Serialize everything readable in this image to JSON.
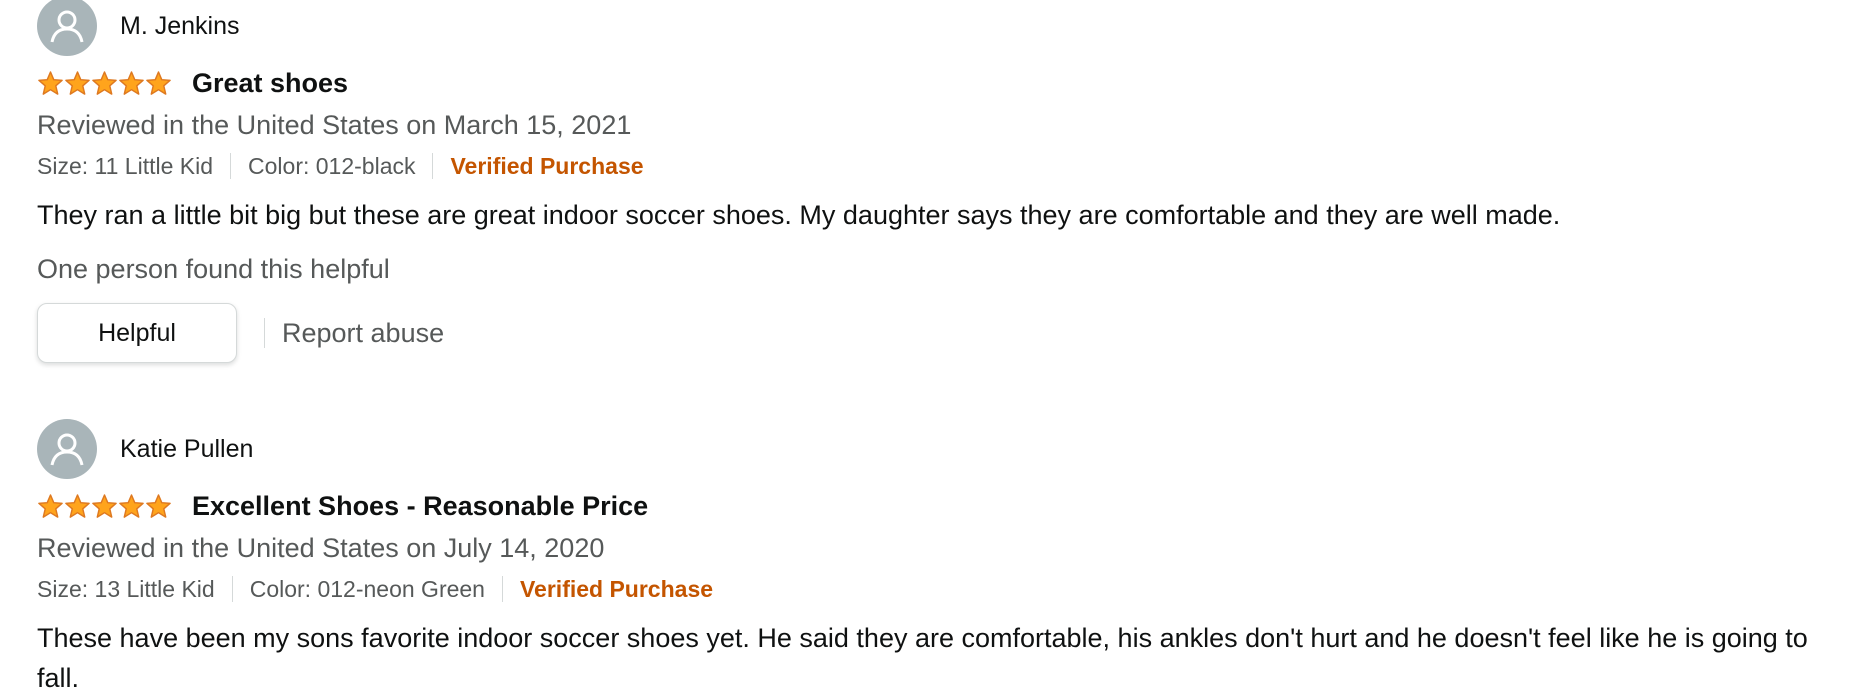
{
  "colors": {
    "star_fill": "#ffa41c",
    "star_stroke": "#de7921",
    "verified": "#c45500",
    "secondary_text": "#565959",
    "avatar_bg": "#a9b5b9"
  },
  "reviews": [
    {
      "profile_name": "M. Jenkins",
      "avatar_icon": "user-silhouette-icon",
      "rating": 5,
      "rating_max": 5,
      "title": "Great shoes",
      "date": "Reviewed in the United States on March 15, 2021",
      "size": "Size: 11 Little Kid",
      "color": "Color: 012-black",
      "verified": "Verified Purchase",
      "body": "They ran a little bit big but these are great indoor soccer shoes. My daughter says they are comfortable and they are well made.",
      "helpful_count": "One person found this helpful",
      "helpful_button": "Helpful",
      "report": "Report abuse"
    },
    {
      "profile_name": "Katie Pullen",
      "avatar_icon": "user-silhouette-icon",
      "rating": 5,
      "rating_max": 5,
      "title": "Excellent Shoes - Reasonable Price",
      "date": "Reviewed in the United States on July 14, 2020",
      "size": "Size: 13 Little Kid",
      "color": "Color: 012-neon Green",
      "verified": "Verified Purchase",
      "body": "These have been my sons favorite indoor soccer shoes yet. He said they are comfortable, his ankles don't hurt and he doesn't feel like he is going to fall."
    }
  ]
}
